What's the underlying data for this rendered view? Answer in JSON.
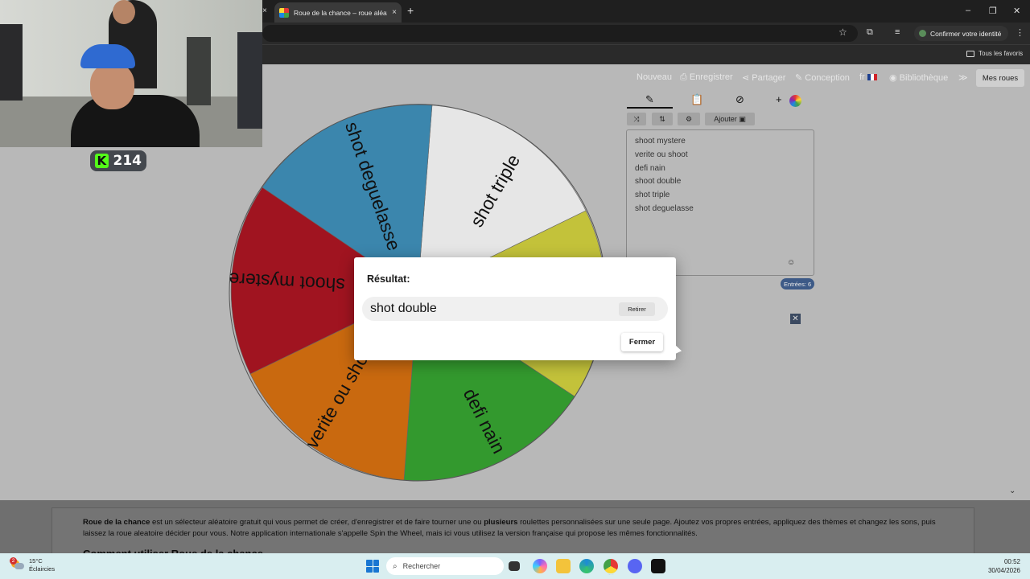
{
  "browser": {
    "tab_title": "Roue de la chance – roue aléatoire",
    "tab_close": "×",
    "left_x": "×",
    "new_tab": "+",
    "win_min": "–",
    "win_max": "❐",
    "win_close": "✕",
    "identity_button": "Confirmer votre identité",
    "all_favorites": "Tous les favoris"
  },
  "webcam": {
    "kick_logo": "K",
    "viewer_count": "214"
  },
  "menu": {
    "nouveau": "Nouveau",
    "enregistrer": "⎙ Enregistrer",
    "partager": "⋖ Partager",
    "conception": "✎ Conception",
    "language": "fr",
    "bibliotheque": "Bibliothèque",
    "more": "≫",
    "mes_roues": "Mes roues"
  },
  "editor": {
    "pencil_icon": "✎",
    "clipboard_icon": "📋",
    "hide_icon": "⊘",
    "plus": "+",
    "shuffle": "⤨",
    "sort": "⇅",
    "settings": "⚙",
    "add_image": "Ajouter ▣",
    "entries": [
      "shoot mystere",
      "verite ou shoot",
      "defi nain",
      "shoot double",
      "shot triple",
      "shot deguelasse"
    ],
    "smiley": "☺",
    "entries_count": "Entrées: 6",
    "close_x": "✕"
  },
  "wheel": {
    "labels": [
      "shot triple",
      "shot deguelasse",
      "shoot mystere",
      "verite ou shoot",
      "defi nain"
    ],
    "colors": {
      "white": "#e6e6e6",
      "yellow": "#c3c23a",
      "green": "#33992e",
      "orange": "#c9690f",
      "red": "#a01420",
      "blue": "#3b86ad"
    }
  },
  "modal": {
    "title": "Résultat:",
    "result": "shot double",
    "remove_button": "Retirer",
    "close_button": "Fermer"
  },
  "description": {
    "text_bold_1": "Roue de la chance",
    "text_1": " est un sélecteur aléatoire gratuit qui vous permet de créer, d'enregistrer et de faire tourner une ou ",
    "text_bold_2": "plusieurs",
    "text_2": " roulettes personnalisées sur une seule page. Ajoutez vos propres entrées, appliquez des thèmes et changez les sons, puis laissez la roue aleatoire décider pour vous. Notre application internationale s'appelle Spin the Wheel, mais ici vous utilisez la version française qui propose les mêmes fonctionnalités.",
    "heading": "Comment utiliser Roue de la chance"
  },
  "taskbar": {
    "weather_badge": "2",
    "temperature": "15°C",
    "weather_desc": "Éclaircies",
    "search_placeholder": "Rechercher",
    "time": "00:52",
    "date": "30/04/2026"
  }
}
